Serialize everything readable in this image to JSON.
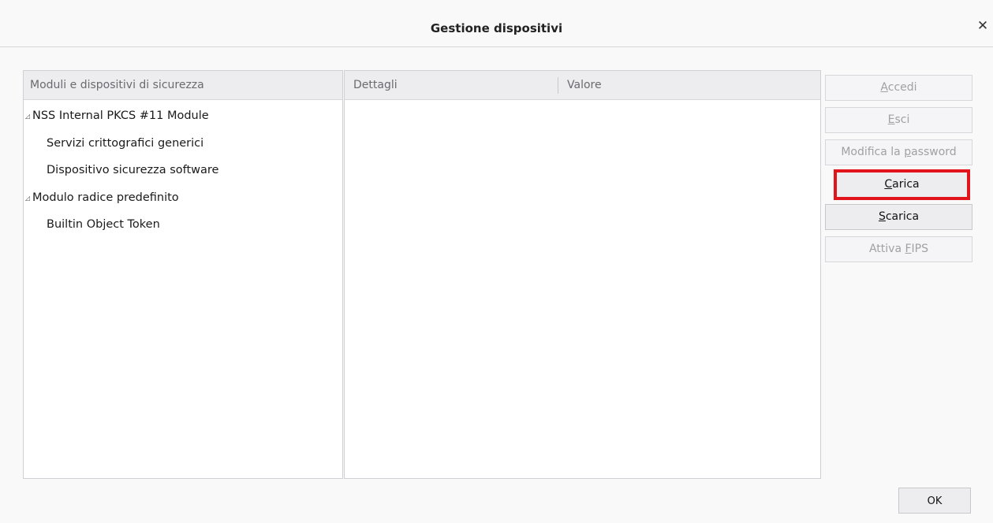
{
  "window": {
    "title": "Gestione dispositivi",
    "close_symbol": "✕"
  },
  "tree": {
    "header": "Moduli e dispositivi di sicurezza",
    "rows": [
      {
        "label": "NSS Internal PKCS #11 Module",
        "level": 0,
        "expanded": true
      },
      {
        "label": "Servizi crittografici generici",
        "level": 1
      },
      {
        "label": "Dispositivo sicurezza software",
        "level": 1
      },
      {
        "label": "Modulo radice predefinito",
        "level": 0,
        "expanded": true
      },
      {
        "label": "Builtin Object Token",
        "level": 1
      }
    ],
    "twisty_symbol": "◿"
  },
  "details": {
    "header_details": "Dettagli",
    "header_value": "Valore"
  },
  "buttons": {
    "login": {
      "pre": "",
      "ul": "A",
      "post": "ccedi",
      "enabled": false
    },
    "logout": {
      "pre": "",
      "ul": "E",
      "post": "sci",
      "enabled": false
    },
    "change_password": {
      "pre": "Modifica la ",
      "ul": "p",
      "post": "assword",
      "enabled": false
    },
    "load": {
      "pre": "",
      "ul": "C",
      "post": "arica",
      "enabled": true,
      "highlighted": true
    },
    "unload": {
      "pre": "",
      "ul": "S",
      "post": "carica",
      "enabled": true
    },
    "enable_fips": {
      "pre": "Attiva ",
      "ul": "F",
      "post": "IPS",
      "enabled": false
    },
    "ok": "OK"
  },
  "colors": {
    "highlight": "#e3131b",
    "disabled_text": "#a0a0a5"
  }
}
